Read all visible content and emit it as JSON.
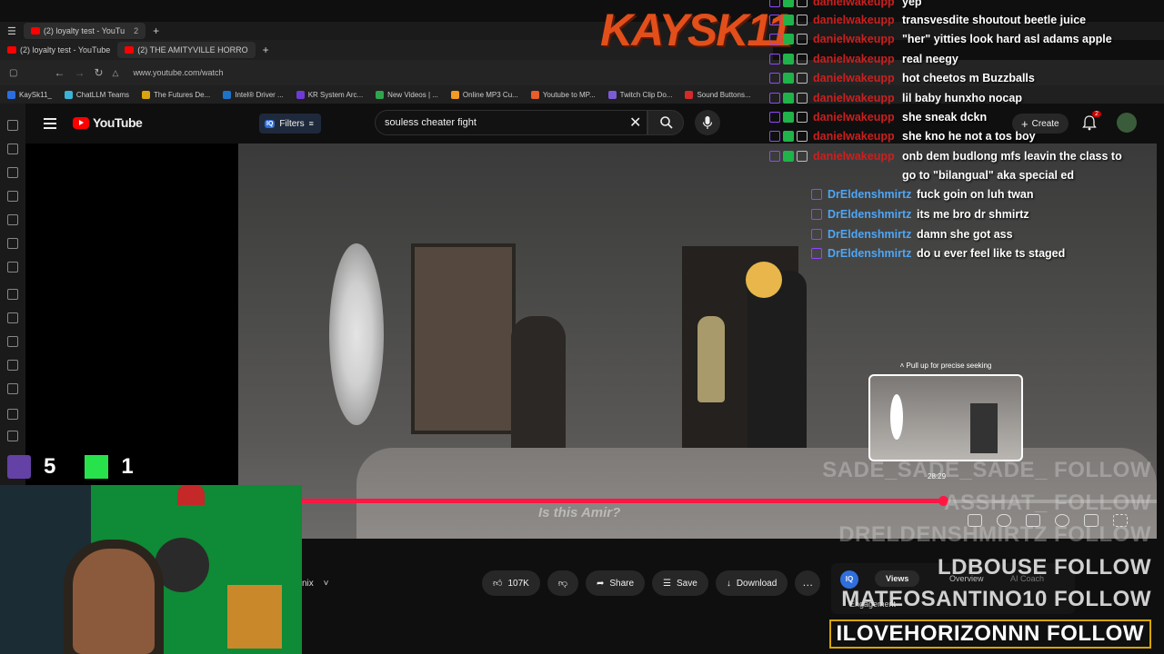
{
  "browser": {
    "tabs_row1": [
      {
        "label": "(2) loyalty test - YouTu",
        "count": "2"
      }
    ],
    "tabs_row2": [
      {
        "label": "(2) loyalty test - YouTube"
      },
      {
        "label": "(2) THE AMITYVILLE HORRO"
      }
    ],
    "url": "www.youtube.com/watch",
    "bookmarks": [
      {
        "label": "KaySk11_",
        "color": "#2a6ee0"
      },
      {
        "label": "ChatLLM Teams",
        "color": "#3bb3d6"
      },
      {
        "label": "The Futures De...",
        "color": "#d9a40f"
      },
      {
        "label": "Intel® Driver ...",
        "color": "#1d72c9"
      },
      {
        "label": "KR System Arc...",
        "color": "#6f3ad6"
      },
      {
        "label": "New Videos | ...",
        "color": "#2fa54d"
      },
      {
        "label": "Online MP3 Cu...",
        "color": "#f29a25"
      },
      {
        "label": "Youtube to MP...",
        "color": "#e85d2a"
      },
      {
        "label": "Twitch Clip Do...",
        "color": "#7b5cd6"
      },
      {
        "label": "Sound Buttons...",
        "color": "#d42a2a"
      }
    ]
  },
  "youtube": {
    "logo_text": "YouTube",
    "filters_label": "Filters",
    "iq_label": "IQ",
    "search_value": "souless cheater fight",
    "create_label": "Create",
    "notification_count": "2"
  },
  "player": {
    "subtitle_text": "Is this Amir?",
    "seek_hint": "Pull up for precise seeking",
    "preview_time": "28:29",
    "progress_fraction": 0.75
  },
  "actions": {
    "mix_label": "nix",
    "like_count": "107K",
    "share_label": "Share",
    "save_label": "Save",
    "download_label": "Download",
    "more_label": "…"
  },
  "iq_panel": {
    "tab_views": "Views",
    "tab_overview": "Overview",
    "tab_ai": "AI Coach",
    "engagement_label": "Engagement"
  },
  "overlay": {
    "logo_text": "KAYSK11",
    "chat": [
      {
        "user": "danielwakeupp",
        "msg": "yep",
        "color": "red"
      },
      {
        "user": "danielwakeupp",
        "msg": "transvesdite shoutout beetle juice",
        "color": "red"
      },
      {
        "user": "danielwakeupp",
        "msg": "\"her\" yitties look hard asl adams apple",
        "color": "red"
      },
      {
        "user": "danielwakeupp",
        "msg": "real neegy",
        "color": "red"
      },
      {
        "user": "danielwakeupp",
        "msg": "hot cheetos m Buzzballs",
        "color": "red"
      },
      {
        "user": "danielwakeupp",
        "msg": "lil baby hunxho nocap",
        "color": "red"
      },
      {
        "user": "danielwakeupp",
        "msg": "she sneak dckn",
        "color": "red"
      },
      {
        "user": "danielwakeupp",
        "msg": "she kno he not a tos boy",
        "color": "red"
      },
      {
        "user": "danielwakeupp",
        "msg": "onb dem budlong mfs leavin the class to go to \"bilangual\" aka special ed",
        "color": "red"
      },
      {
        "user": "DrEldenshmirtz",
        "msg": "fuck goin on luh twan",
        "color": "blue"
      },
      {
        "user": "DrEldenshmirtz",
        "msg": "its me bro dr shmirtz",
        "color": "blue"
      },
      {
        "user": "DrEldenshmirtz",
        "msg": "damn she got ass",
        "color": "blue"
      },
      {
        "user": "DrEldenshmirtz",
        "msg": "do u ever feel like ts staged",
        "color": "blue"
      }
    ],
    "follows": [
      {
        "text": "SADE_SADE_SADE_  FOLLOW",
        "dim": true
      },
      {
        "text": "ASSHAT_  FOLLOW",
        "dim": true
      },
      {
        "text": "DRELDENSHMIRTZ  FOLLOW",
        "dim": true
      },
      {
        "text": "LDBOUSE  FOLLOW",
        "dim": false
      },
      {
        "text": "MATEOSANTINO10  FOLLOW",
        "dim": false
      },
      {
        "text": "ILOVEHORIZONNN  FOLLOW",
        "dim": false
      }
    ],
    "twitch_viewers": "5",
    "kick_viewers": "1"
  }
}
